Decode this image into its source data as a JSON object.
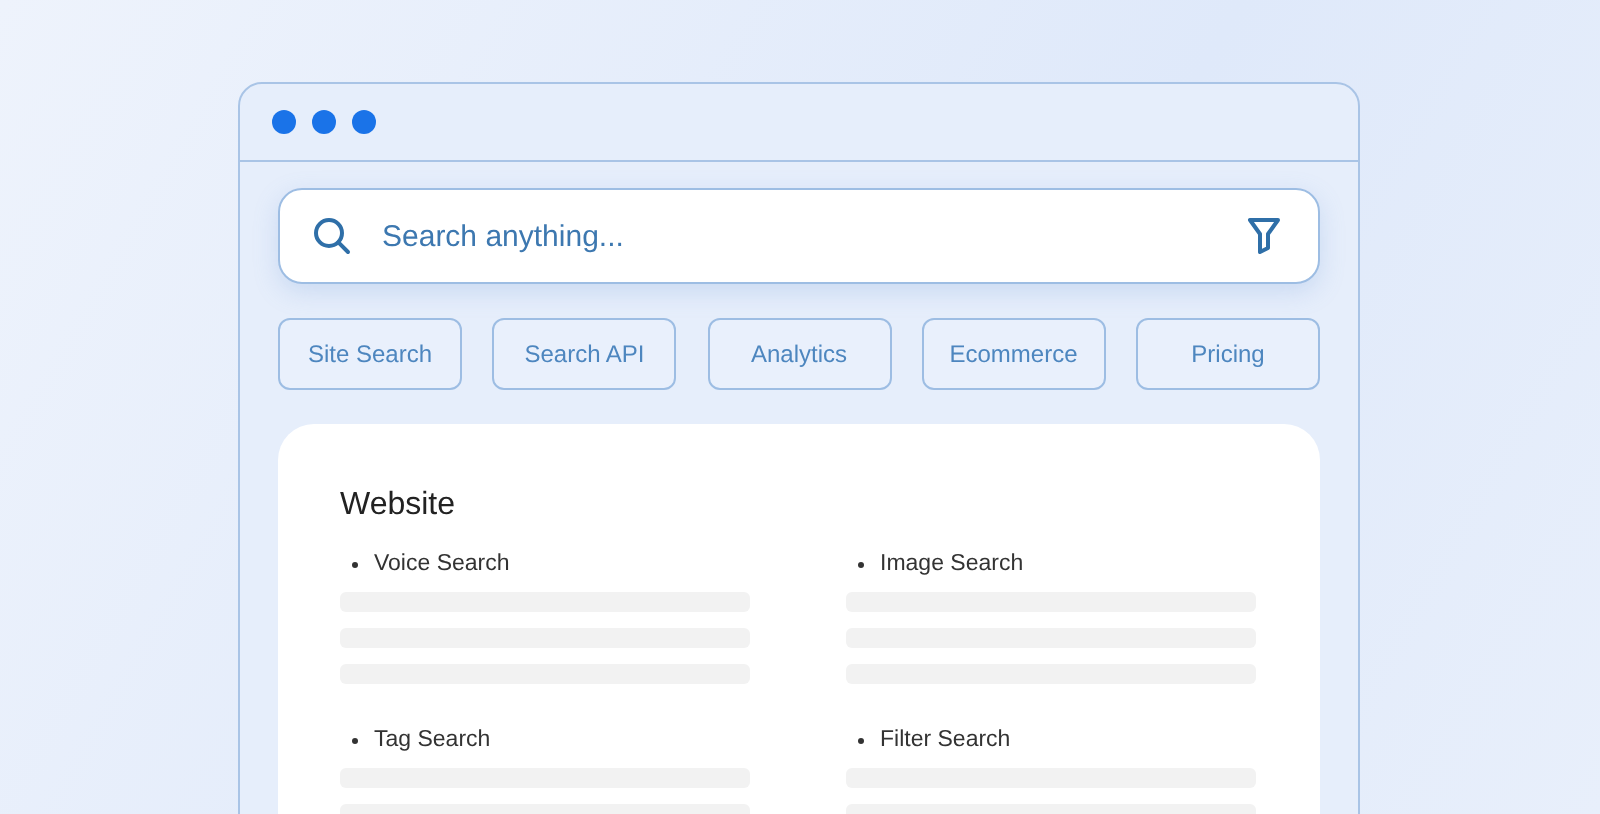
{
  "search": {
    "placeholder": "Search anything..."
  },
  "chips": [
    {
      "label": "Site Search"
    },
    {
      "label": "Search API"
    },
    {
      "label": "Analytics"
    },
    {
      "label": "Ecommerce"
    },
    {
      "label": "Pricing"
    }
  ],
  "card": {
    "title": "Website",
    "items": [
      {
        "label": "Voice Search"
      },
      {
        "label": "Image Search"
      },
      {
        "label": "Tag Search"
      },
      {
        "label": "Filter Search"
      }
    ]
  }
}
